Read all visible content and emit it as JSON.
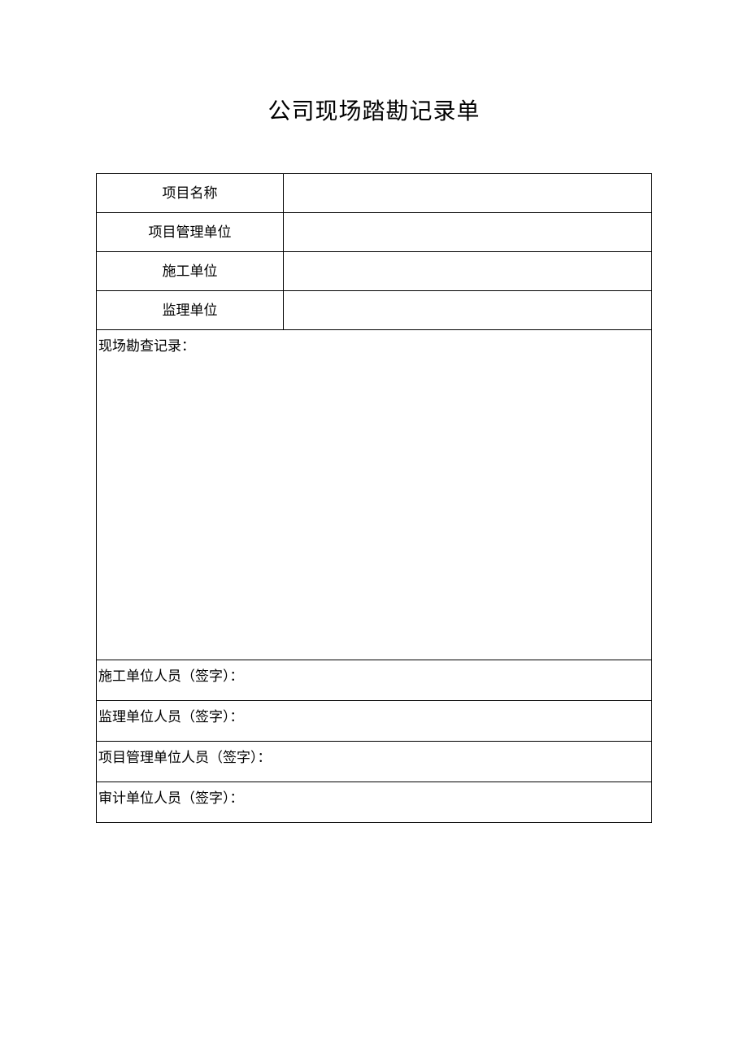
{
  "title": "公司现场踏勘记录单",
  "rows": {
    "project_name_label": "项目名称",
    "project_name_value": "",
    "pm_unit_label": "项目管理单位",
    "pm_unit_value": "",
    "construction_unit_label": "施工单位",
    "construction_unit_value": "",
    "supervision_unit_label": "监理单位",
    "supervision_unit_value": ""
  },
  "survey_record_label": "现场勘查记录：",
  "signatures": {
    "construction": "施工单位人员（签字）：",
    "supervision": "监理单位人员（签字）：",
    "project_management": "项目管理单位人员（签字）：",
    "audit": "审计单位人员（签字）："
  }
}
